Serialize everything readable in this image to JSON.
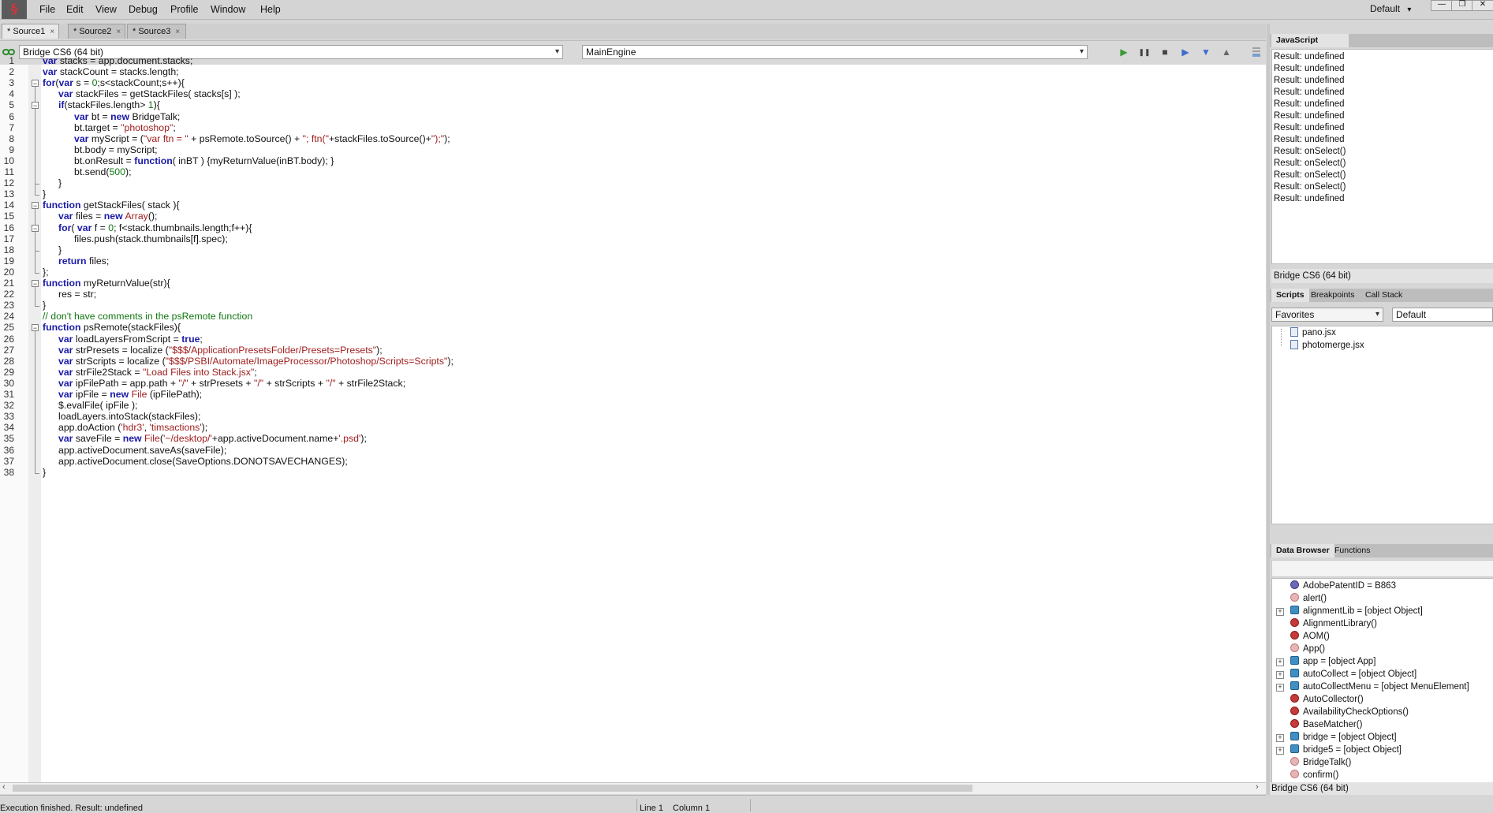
{
  "menu": [
    "File",
    "Edit",
    "View",
    "Debug",
    "Profile",
    "Window",
    "Help"
  ],
  "workspace": {
    "label": "Default",
    "arrow": "▾"
  },
  "window_controls": [
    "—",
    "❐",
    "✕"
  ],
  "tabs": [
    {
      "label": "* Source1",
      "close": "×"
    },
    {
      "label": "* Source2",
      "close": "×"
    },
    {
      "label": "* Source3",
      "close": "×"
    }
  ],
  "toolbar": {
    "target": "Bridge CS6 (64 bit)",
    "engine": "MainEngine",
    "controls": {
      "run": "▶",
      "pause": "❚❚",
      "stop": "■",
      "step_over": "▶",
      "step_into": "▼",
      "step_out": "▲"
    }
  },
  "editor": {
    "lines": [
      {
        "n": "1",
        "i": 0,
        "code": "var stacks = app.document.stacks;"
      },
      {
        "n": "2",
        "i": 0,
        "code": "var stackCount = stacks.length;"
      },
      {
        "n": "3",
        "i": 0,
        "code": "for(var s = 0;s<stackCount;s++){"
      },
      {
        "n": "4",
        "i": 1,
        "code": "var stackFiles = getStackFiles( stacks[s] );"
      },
      {
        "n": "5",
        "i": 1,
        "code": "if(stackFiles.length> 1){"
      },
      {
        "n": "6",
        "i": 2,
        "code": "var bt = new BridgeTalk;"
      },
      {
        "n": "7",
        "i": 2,
        "code": "bt.target = \"photoshop\";"
      },
      {
        "n": "8",
        "i": 2,
        "code": "var myScript = (\"var ftn = \" + psRemote.toSource() + \"; ftn(\"+stackFiles.toSource()+\");\");"
      },
      {
        "n": "9",
        "i": 2,
        "code": "bt.body = myScript;"
      },
      {
        "n": "10",
        "i": 2,
        "code": "bt.onResult = function( inBT ) {myReturnValue(inBT.body); }"
      },
      {
        "n": "11",
        "i": 2,
        "code": "bt.send(500);"
      },
      {
        "n": "12",
        "i": 1,
        "code": "}"
      },
      {
        "n": "13",
        "i": 0,
        "code": "}"
      },
      {
        "n": "14",
        "i": 0,
        "code": "function getStackFiles( stack ){"
      },
      {
        "n": "15",
        "i": 1,
        "code": "var files = new Array();"
      },
      {
        "n": "16",
        "i": 1,
        "code": "for( var f = 0; f<stack.thumbnails.length;f++){"
      },
      {
        "n": "17",
        "i": 2,
        "code": "files.push(stack.thumbnails[f].spec);"
      },
      {
        "n": "18",
        "i": 1,
        "code": "}"
      },
      {
        "n": "19",
        "i": 1,
        "code": "return files;"
      },
      {
        "n": "20",
        "i": 0,
        "code": "};"
      },
      {
        "n": "21",
        "i": 0,
        "code": "function myReturnValue(str){"
      },
      {
        "n": "22",
        "i": 1,
        "code": "res = str;"
      },
      {
        "n": "23",
        "i": 0,
        "code": "}"
      },
      {
        "n": "24",
        "i": 0,
        "code": "// don't have comments in the psRemote function"
      },
      {
        "n": "25",
        "i": 0,
        "code": "function psRemote(stackFiles){"
      },
      {
        "n": "26",
        "i": 1,
        "code": "var loadLayersFromScript = true;"
      },
      {
        "n": "27",
        "i": 1,
        "code": "var strPresets = localize (\"$$$/ApplicationPresetsFolder/Presets=Presets\");"
      },
      {
        "n": "28",
        "i": 1,
        "code": "var strScripts = localize (\"$$$/PSBI/Automate/ImageProcessor/Photoshop/Scripts=Scripts\");"
      },
      {
        "n": "29",
        "i": 1,
        "code": "var strFile2Stack = \"Load Files into Stack.jsx\";"
      },
      {
        "n": "30",
        "i": 1,
        "code": "var ipFilePath = app.path + \"/\" + strPresets + \"/\" + strScripts + \"/\" + strFile2Stack;"
      },
      {
        "n": "31",
        "i": 1,
        "code": "var ipFile = new File (ipFilePath);"
      },
      {
        "n": "32",
        "i": 1,
        "code": "$.evalFile( ipFile );"
      },
      {
        "n": "33",
        "i": 1,
        "code": "loadLayers.intoStack(stackFiles);"
      },
      {
        "n": "34",
        "i": 1,
        "code": "app.doAction ('hdr3', 'timsactions');"
      },
      {
        "n": "35",
        "i": 1,
        "code": "var saveFile = new File('~/desktop/'+app.activeDocument.name+'.psd');"
      },
      {
        "n": "36",
        "i": 1,
        "code": "app.activeDocument.saveAs(saveFile);"
      },
      {
        "n": "37",
        "i": 1,
        "code": "app.activeDocument.close(SaveOptions.DONOTSAVECHANGES);"
      },
      {
        "n": "38",
        "i": 0,
        "code": "}"
      }
    ]
  },
  "status": {
    "message": "Execution finished. Result: undefined",
    "line": "Line 1",
    "column": "Column 1"
  },
  "console": {
    "tab": "JavaScript Console",
    "results": [
      "Result: undefined",
      "Result: undefined",
      "Result: undefined",
      "Result: undefined",
      "Result: undefined",
      "Result: undefined",
      "Result: undefined",
      "Result: undefined",
      "Result: onSelect()",
      "Result: onSelect()",
      "Result: onSelect()",
      "Result: onSelect()",
      "Result: undefined"
    ],
    "footer": "Bridge CS6 (64 bit)"
  },
  "scripts_panel": {
    "tabs": [
      "Scripts",
      "Breakpoints",
      "Call Stack"
    ],
    "favorites": "Favorites",
    "scope": "Default",
    "files": [
      "pano.jsx",
      "photomerge.jsx"
    ]
  },
  "data_browser": {
    "tabs": [
      "Data Browser",
      "Functions"
    ],
    "items": [
      {
        "label": "AdobePatentID = B863",
        "kind": "val",
        "expand": false
      },
      {
        "label": "alert()",
        "kind": "fnl",
        "expand": false
      },
      {
        "label": "alignmentLib = [object Object]",
        "kind": "obj",
        "expand": true
      },
      {
        "label": "AlignmentLibrary()",
        "kind": "fn",
        "expand": false
      },
      {
        "label": "AOM()",
        "kind": "fn",
        "expand": false
      },
      {
        "label": "App()",
        "kind": "fnl",
        "expand": false
      },
      {
        "label": "app = [object App]",
        "kind": "obj",
        "expand": true
      },
      {
        "label": "autoCollect = [object Object]",
        "kind": "obj",
        "expand": true
      },
      {
        "label": "autoCollectMenu = [object MenuElement]",
        "kind": "obj",
        "expand": true
      },
      {
        "label": "AutoCollector()",
        "kind": "fn",
        "expand": false
      },
      {
        "label": "AvailabilityCheckOptions()",
        "kind": "fn",
        "expand": false
      },
      {
        "label": "BaseMatcher()",
        "kind": "fn",
        "expand": false
      },
      {
        "label": "bridge = [object Object]",
        "kind": "obj",
        "expand": true
      },
      {
        "label": "bridge5 = [object Object]",
        "kind": "obj",
        "expand": true
      },
      {
        "label": "BridgeTalk()",
        "kind": "fnl",
        "expand": false
      },
      {
        "label": "confirm()",
        "kind": "fnl",
        "expand": false
      }
    ],
    "footer": "Bridge CS6 (64 bit)"
  },
  "colors": {
    "keyword": "#1a1aa6",
    "string": "#a01e1e",
    "number": "#117711",
    "comment": "#117711",
    "builtin": "#a01e1e"
  }
}
